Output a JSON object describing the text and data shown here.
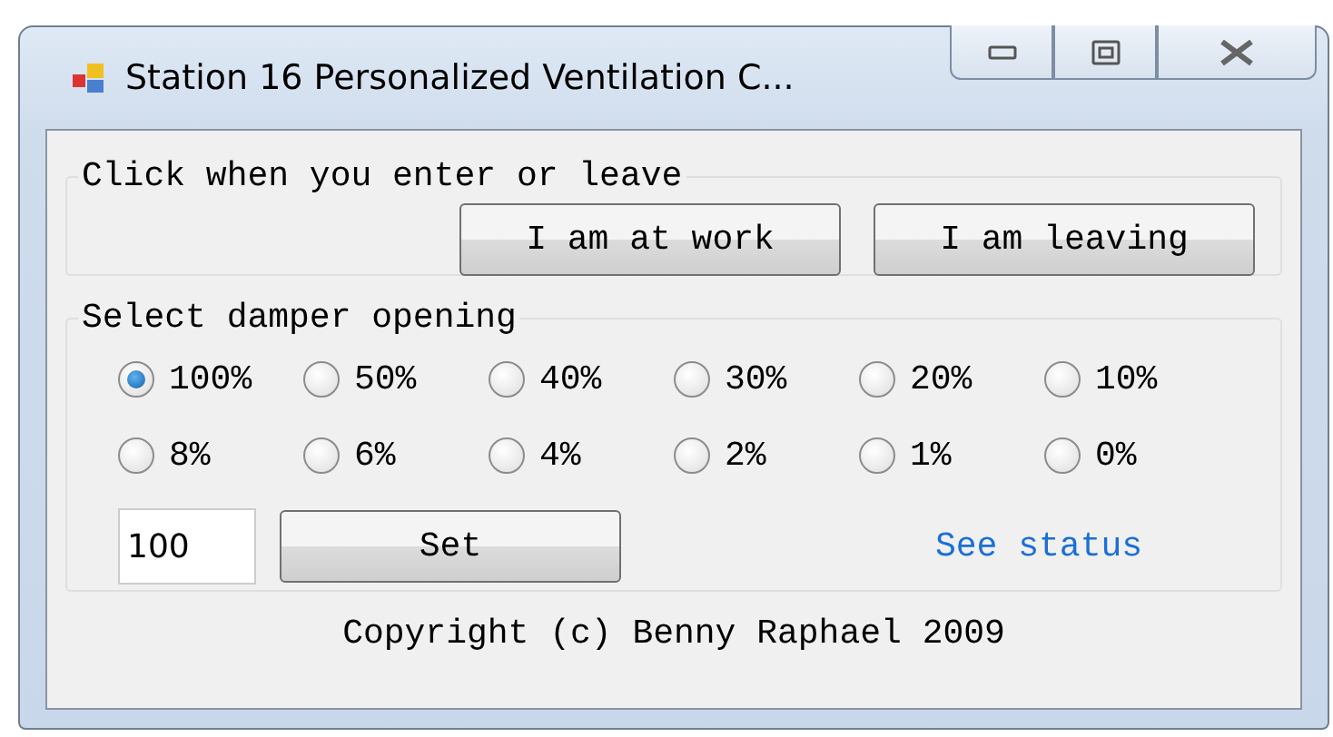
{
  "window": {
    "title": "Station 16 Personalized Ventilation C..."
  },
  "attendance": {
    "legend": "Click when you enter or leave",
    "buttons": [
      "I am at work",
      "I am leaving"
    ]
  },
  "damper": {
    "legend": "Select damper opening",
    "options": [
      {
        "label": "100%",
        "selected": true
      },
      {
        "label": "50%",
        "selected": false
      },
      {
        "label": "40%",
        "selected": false
      },
      {
        "label": "30%",
        "selected": false
      },
      {
        "label": "20%",
        "selected": false
      },
      {
        "label": "10%",
        "selected": false
      },
      {
        "label": "8%",
        "selected": false
      },
      {
        "label": "6%",
        "selected": false
      },
      {
        "label": "4%",
        "selected": false
      },
      {
        "label": "2%",
        "selected": false
      },
      {
        "label": "1%",
        "selected": false
      },
      {
        "label": "0%",
        "selected": false
      }
    ],
    "value": "100",
    "set_button": "Set",
    "status_link": "See status"
  },
  "footer": "Copyright (c) Benny Raphael 2009"
}
